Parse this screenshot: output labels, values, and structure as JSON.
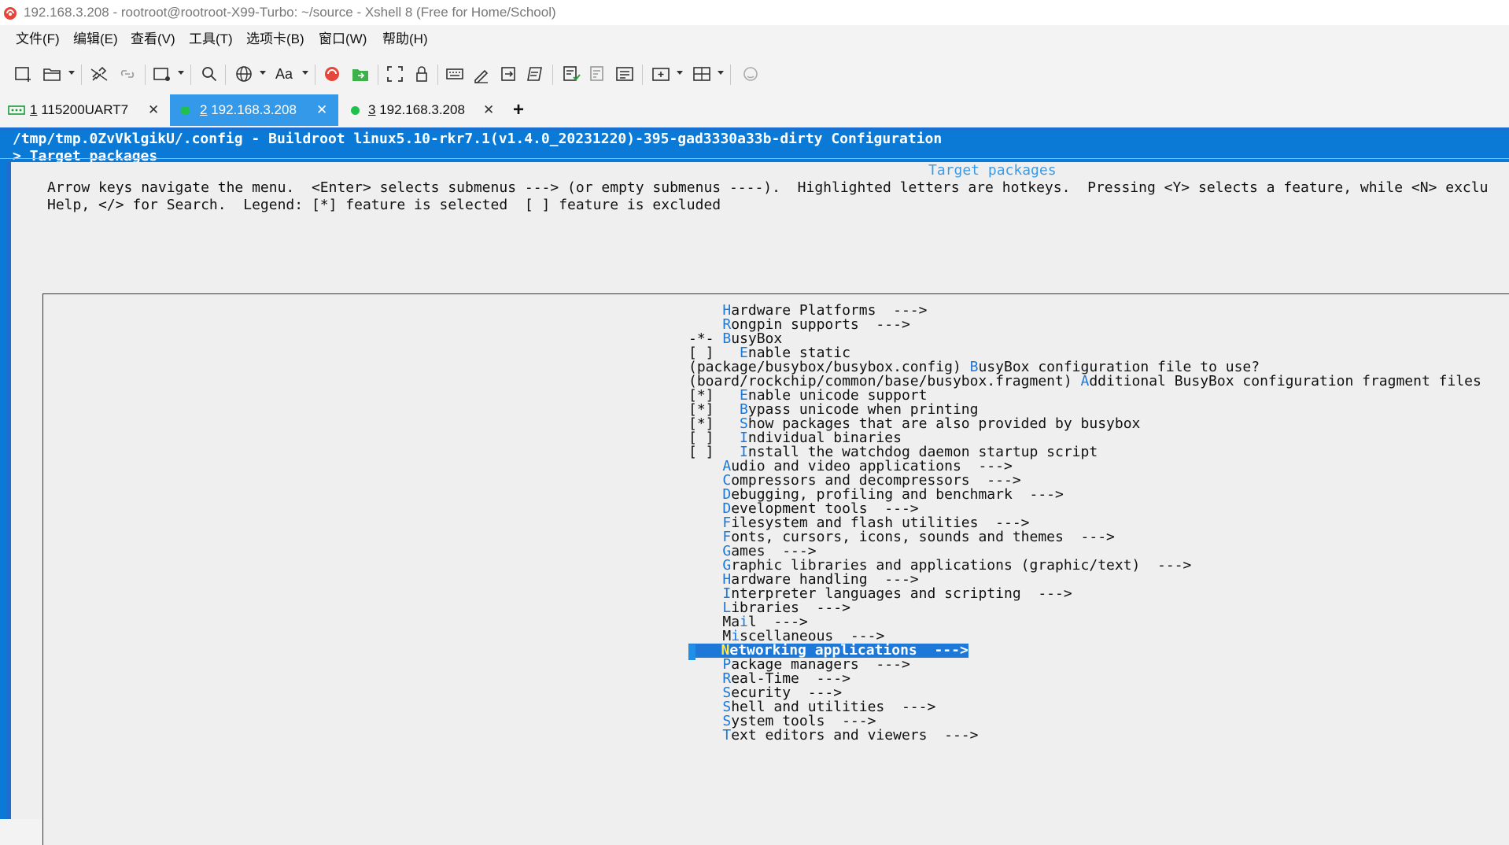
{
  "window": {
    "title": "192.168.3.208 - rootroot@rootroot-X99-Turbo: ~/source - Xshell 8 (Free for Home/School)"
  },
  "menu": [
    "文件(F)",
    "编辑(E)",
    "查看(V)",
    "工具(T)",
    "选项卡(B)",
    "窗口(W)",
    "帮助(H)"
  ],
  "toolbar": {
    "font_label": "Aa",
    "icons": [
      "new-session-icon",
      "open-folder-icon",
      "reconnect-icon",
      "disconnect-icon",
      "new-tab-icon",
      "find-icon",
      "globe-icon",
      "font-icon",
      "xshell-logo-icon",
      "xftp-icon",
      "fullscreen-icon",
      "lock-icon",
      "keyboard-icon",
      "script-icon",
      "transfer-icon",
      "log-icon",
      "compose-icon",
      "quick-command-icon",
      "compose-bar-icon",
      "add-pane-icon",
      "layout-icon",
      "chat-icon"
    ]
  },
  "tabs": [
    {
      "num": "1",
      "label": " 115200UART7",
      "status": "serial"
    },
    {
      "num": "2",
      "label": " 192.168.3.208",
      "status": "connected"
    },
    {
      "num": "3",
      "label": " 192.168.3.208",
      "status": "connected"
    }
  ],
  "tab_add": "+",
  "tab_close": "✕",
  "terminal": {
    "header_line1": "/tmp/tmp.0ZvVklgikU/.config - Buildroot linux5.10-rkr7.1(v1.4.0_20231220)-395-gad3330a33b-dirty Configuration",
    "header_line2": "> Target packages",
    "dialog_title": "Target packages",
    "help_line1": "Arrow keys navigate the menu.  <Enter> selects submenus ---> (or empty submenus ----).  Highlighted letters are hotkeys.  Pressing <Y> selects a feature, while <N> exclu",
    "help_line2": "Help, </> for Search.  Legend: [*] feature is selected  [ ] feature is excluded",
    "items": [
      {
        "prefix": "    ",
        "hot": "H",
        "rest": "ardware Platforms  --->"
      },
      {
        "prefix": "    ",
        "hot": "R",
        "rest": "ongpin supports  --->"
      },
      {
        "prefix": "-*- ",
        "hot": "B",
        "rest": "usyBox"
      },
      {
        "prefix": "[ ]   ",
        "hot": "E",
        "rest": "nable static"
      },
      {
        "prefix": "(package/busybox/busybox.config) ",
        "hot": "B",
        "rest": "usyBox configuration file to use?"
      },
      {
        "prefix": "(board/rockchip/common/base/busybox.fragment) ",
        "hot": "A",
        "rest": "dditional BusyBox configuration fragment files"
      },
      {
        "prefix": "[*]   ",
        "hot": "E",
        "rest": "nable unicode support"
      },
      {
        "prefix": "[*]   ",
        "hot": "B",
        "rest": "ypass unicode when printing"
      },
      {
        "prefix": "[*]   ",
        "hot": "S",
        "rest": "how packages that are also provided by busybox"
      },
      {
        "prefix": "[ ]   ",
        "hot": "I",
        "rest": "ndividual binaries"
      },
      {
        "prefix": "[ ]   ",
        "hot": "I",
        "rest": "nstall the watchdog daemon startup script"
      },
      {
        "prefix": "    ",
        "hot": "A",
        "rest": "udio and video applications  --->"
      },
      {
        "prefix": "    ",
        "hot": "C",
        "rest": "ompressors and decompressors  --->"
      },
      {
        "prefix": "    ",
        "hot": "D",
        "rest": "ebugging, profiling and benchmark  --->"
      },
      {
        "prefix": "    ",
        "hot": "D",
        "rest": "evelopment tools  --->"
      },
      {
        "prefix": "    ",
        "hot": "F",
        "rest": "ilesystem and flash utilities  --->"
      },
      {
        "prefix": "    ",
        "hot": "F",
        "rest": "onts, cursors, icons, sounds and themes  --->"
      },
      {
        "prefix": "    ",
        "hot": "G",
        "rest": "ames  --->"
      },
      {
        "prefix": "    ",
        "hot": "G",
        "rest": "raphic libraries and applications (graphic/text)  --->"
      },
      {
        "prefix": "    ",
        "hot": "H",
        "rest": "ardware handling  --->"
      },
      {
        "prefix": "    ",
        "hot": "I",
        "rest": "nterpreter languages and scripting  --->"
      },
      {
        "prefix": "    ",
        "hot": "L",
        "rest": "ibraries  --->"
      },
      {
        "prefix": "    ",
        "pre": "Ma",
        "hot": "i",
        "rest": "l  --->"
      },
      {
        "prefix": "    ",
        "pre": "M",
        "hot": "i",
        "rest": "scellaneous  --->"
      },
      {
        "prefix": "    ",
        "pre": "",
        "hot": "N",
        "rest": "etworking applications  --->",
        "selected": true
      },
      {
        "prefix": "    ",
        "hot": "P",
        "rest": "ackage managers  --->"
      },
      {
        "prefix": "    ",
        "hot": "R",
        "rest": "eal-Time  --->"
      },
      {
        "prefix": "    ",
        "hot": "S",
        "rest": "ecurity  --->"
      },
      {
        "prefix": "    ",
        "hot": "S",
        "rest": "hell and utilities  --->"
      },
      {
        "prefix": "    ",
        "hot": "S",
        "rest": "ystem tools  --->"
      },
      {
        "prefix": "    ",
        "hot": "T",
        "rest": "ext editors and viewers  --->"
      }
    ]
  }
}
